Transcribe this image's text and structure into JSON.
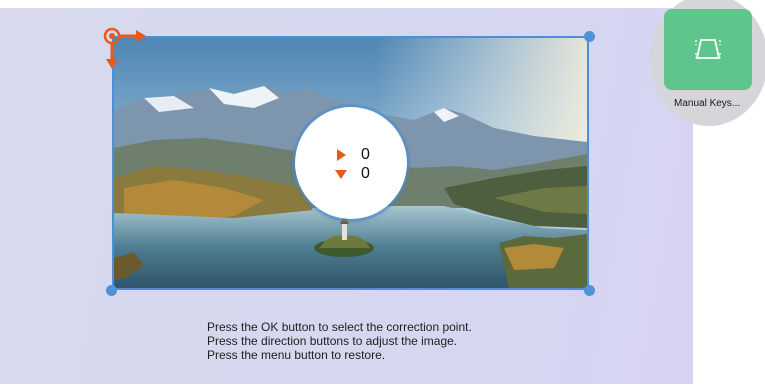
{
  "correction": {
    "horizontal_value": "0",
    "vertical_value": "0",
    "horizontal_icon": "triangle-right-icon",
    "vertical_icon": "triangle-down-icon",
    "active_corner": "top-left"
  },
  "instructions": {
    "line1": "Press the OK button to select the correction point.",
    "line2": "Press the direction buttons to adjust the image.",
    "line3": "Press the menu button to restore."
  },
  "mode": {
    "label": "Manual Keys...",
    "icon": "keystone-icon"
  },
  "colors": {
    "accent": "#4a90d9",
    "active_handle": "#e8591a",
    "mode_tile": "#5ec68c",
    "value_arrow": "#e8591a"
  }
}
